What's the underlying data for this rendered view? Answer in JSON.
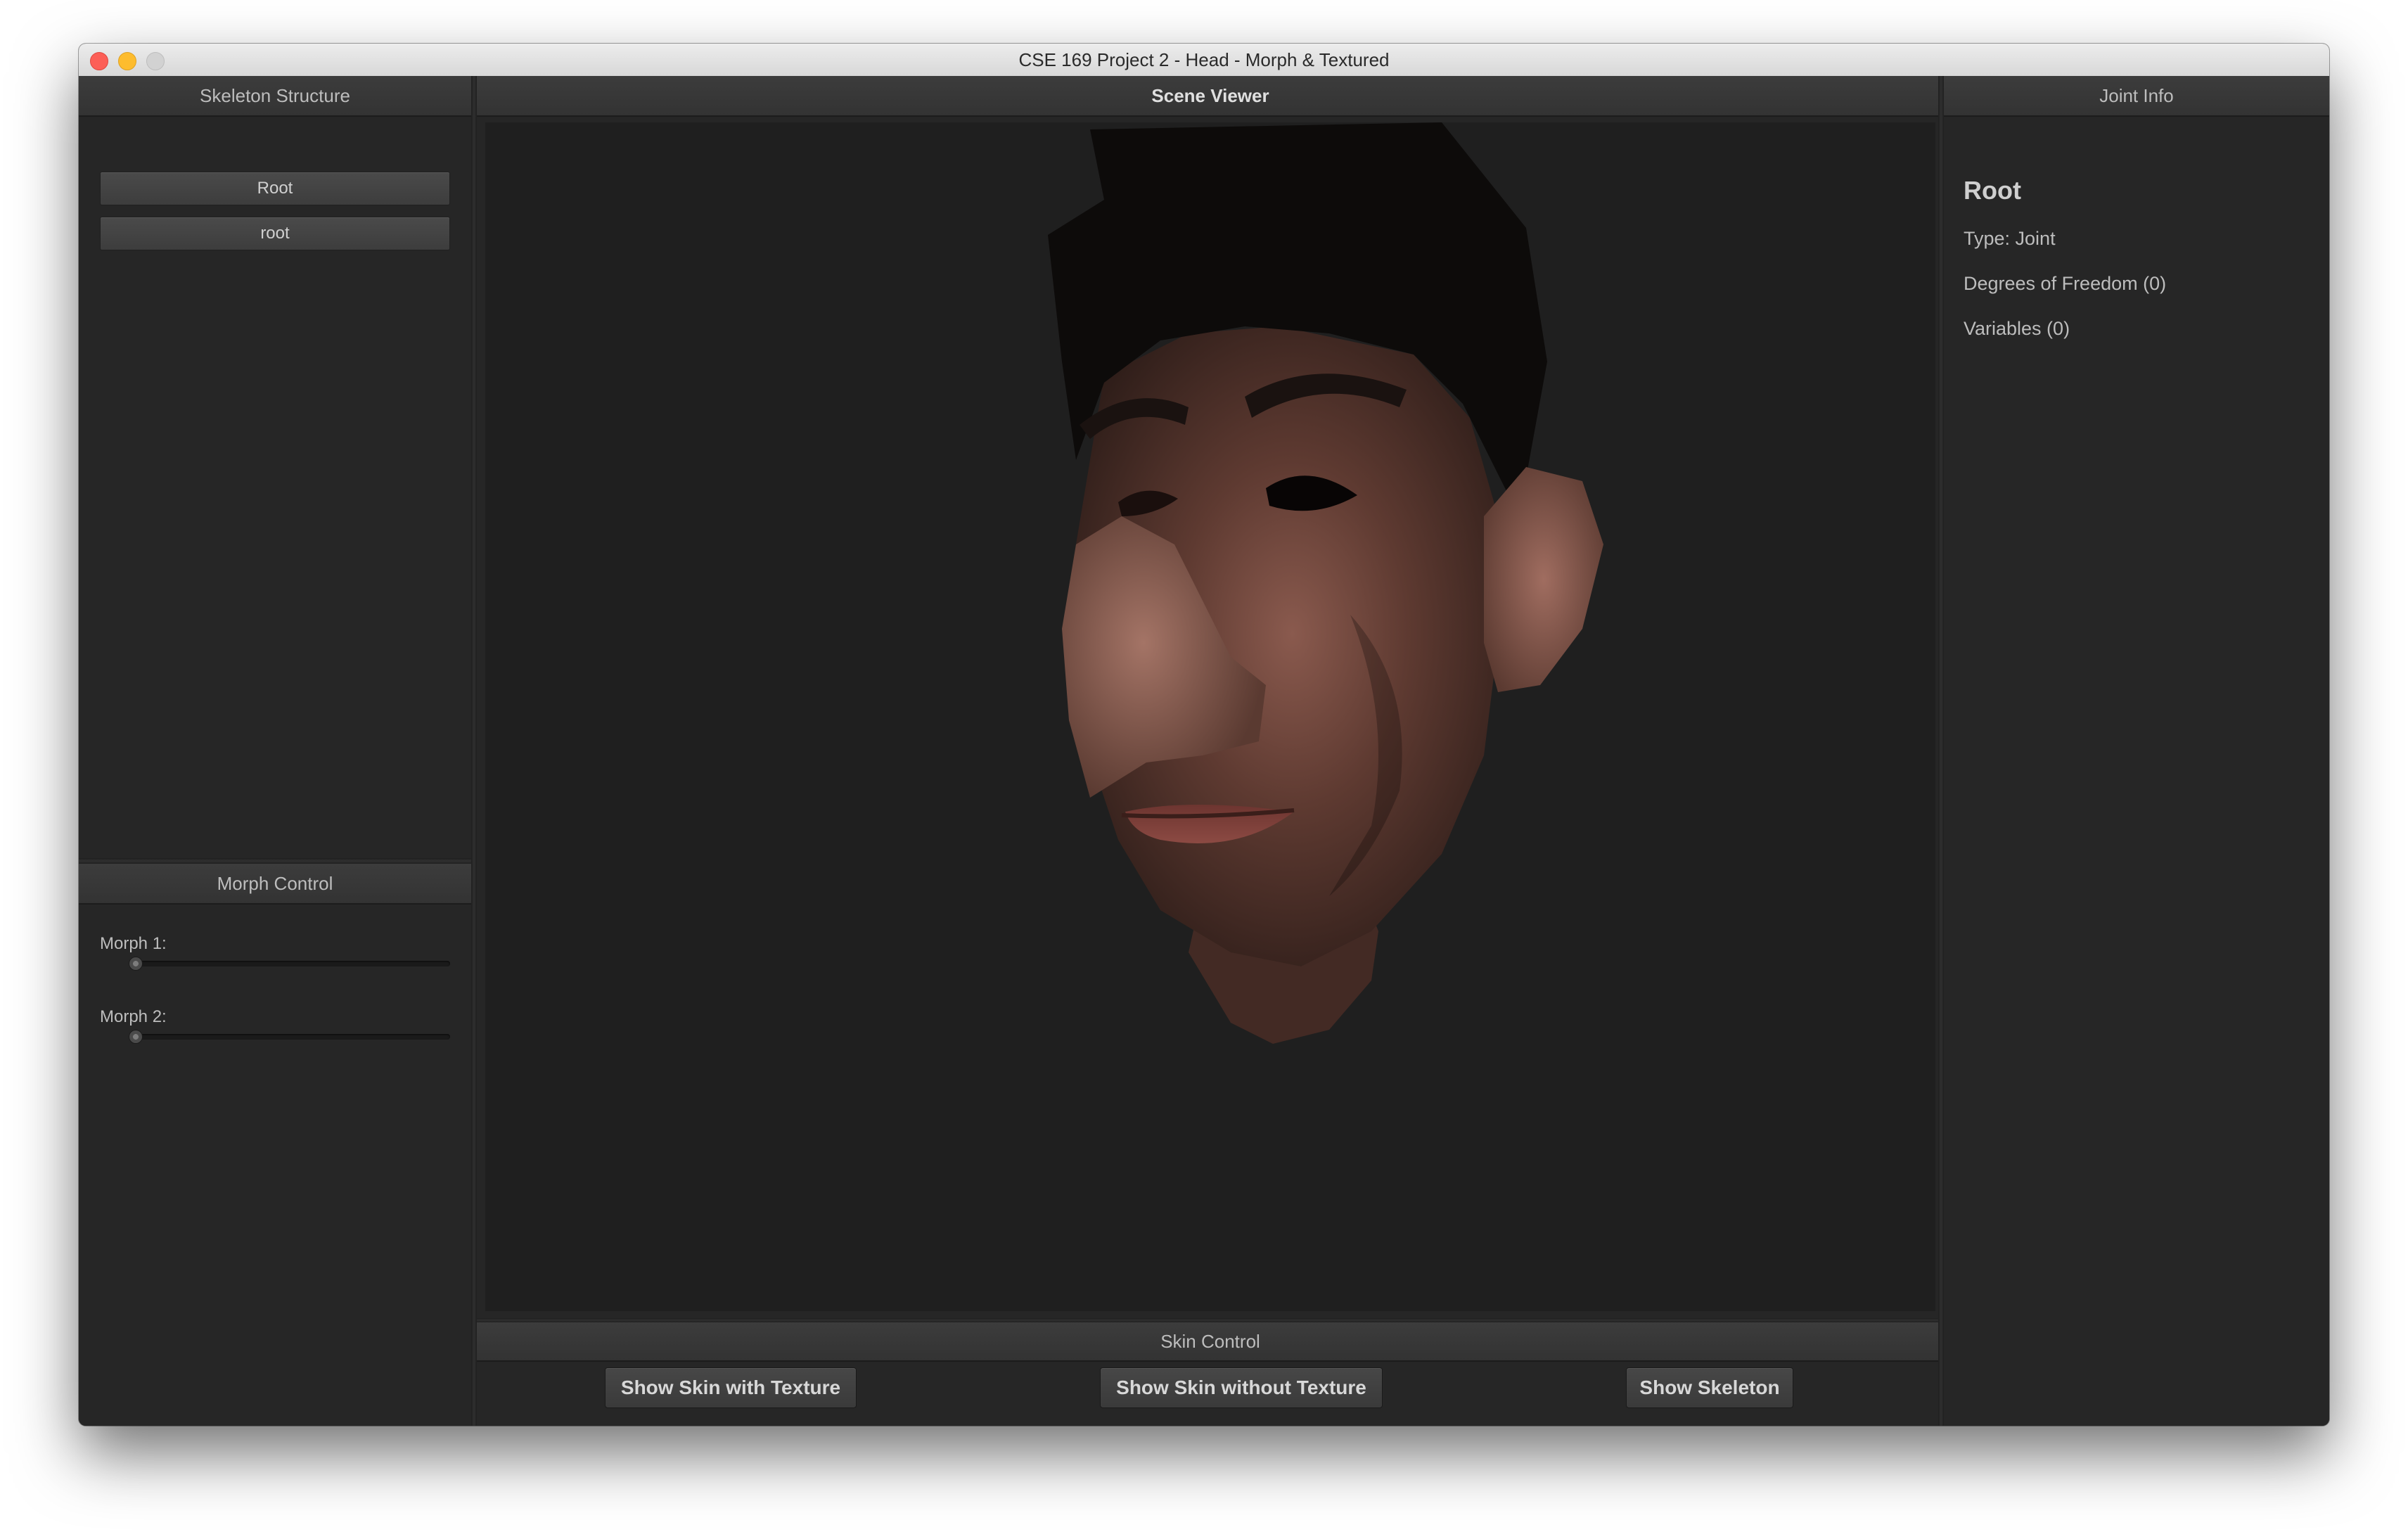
{
  "window": {
    "title": "CSE 169 Project 2 - Head - Morph & Textured"
  },
  "skeleton_panel": {
    "header": "Skeleton Structure",
    "items": [
      {
        "label": "Root"
      },
      {
        "label": "root"
      }
    ]
  },
  "morph_panel": {
    "header": "Morph Control",
    "morphs": [
      {
        "label": "Morph 1:",
        "value": 0
      },
      {
        "label": "Morph 2:",
        "value": 0
      }
    ]
  },
  "scene_panel": {
    "header": "Scene Viewer",
    "content": "textured 3D head model"
  },
  "skin_panel": {
    "header": "Skin Control",
    "buttons": {
      "textured": "Show Skin with Texture",
      "untextured": "Show Skin without Texture",
      "skeleton": "Show Skeleton"
    }
  },
  "joint_panel": {
    "header": "Joint Info",
    "title": "Root",
    "type": "Type: Joint",
    "dof": "Degrees of Freedom (0)",
    "variables": "Variables (0)"
  }
}
